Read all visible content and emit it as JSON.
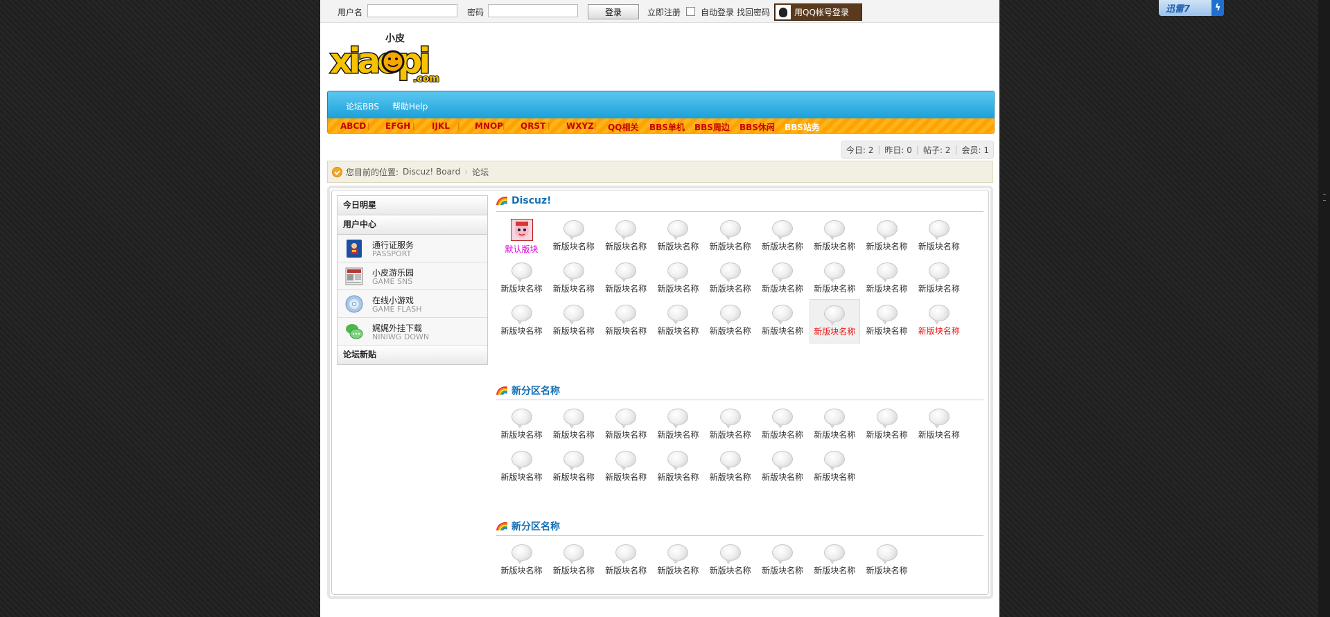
{
  "login": {
    "username_label": "用户名",
    "password_label": "密码",
    "login_button": "登录",
    "register": "立即注册",
    "auto_login": "自动登录",
    "find_password": "找回密码",
    "qq_login": "用QQ帐号登录"
  },
  "logo": {
    "small_text": "小皮",
    "main_text": "xiaopi",
    "sub": ".com"
  },
  "nav": {
    "items": [
      "论坛BBS",
      "帮助Help"
    ]
  },
  "subnav": {
    "items": [
      "ABCD",
      "EFGH",
      "IJKL",
      "MNOP",
      "QRST",
      "WXYZ",
      "QQ相关",
      "BBS单机",
      "BBS周边",
      "BBS休闲",
      "BBS站务"
    ]
  },
  "stats": {
    "today": "今日: 2",
    "yesterday": "昨日: 0",
    "posts": "帖子: 2",
    "members": "会员: 1"
  },
  "breadcrumb": {
    "prefix": "您目前的位置:",
    "items": [
      "Discuz! Board",
      "论坛"
    ]
  },
  "sidebar": {
    "header1": "今日明星",
    "header2": "用户中心",
    "items": [
      {
        "title": "通行证服务",
        "sub": "PASSPORT",
        "icon": "passport-icon"
      },
      {
        "title": "小皮游乐园",
        "sub": "GAME SNS",
        "icon": "newspaper-icon"
      },
      {
        "title": "在线小游戏",
        "sub": "GAME FLASH",
        "icon": "disc-icon"
      },
      {
        "title": "娓娓外挂下载",
        "sub": "NINIWG DOWN",
        "icon": "chat-icon"
      }
    ],
    "header3": "论坛新贴"
  },
  "sections": [
    {
      "title": "Discuz!",
      "default_forum": "默认版块",
      "forum_name": "新版块名称",
      "count": 27
    },
    {
      "title": "新分区名称",
      "forum_name": "新版块名称",
      "count": 16
    },
    {
      "title": "新分区名称",
      "forum_name": "新版块名称",
      "count": 8
    }
  ],
  "xunlei": {
    "label": "迅雷7"
  },
  "colors": {
    "nav_blue": "#1aa0d8",
    "subnav_orange": "#ffa200",
    "link_red": "#c60000",
    "section_blue": "#1670b5"
  }
}
